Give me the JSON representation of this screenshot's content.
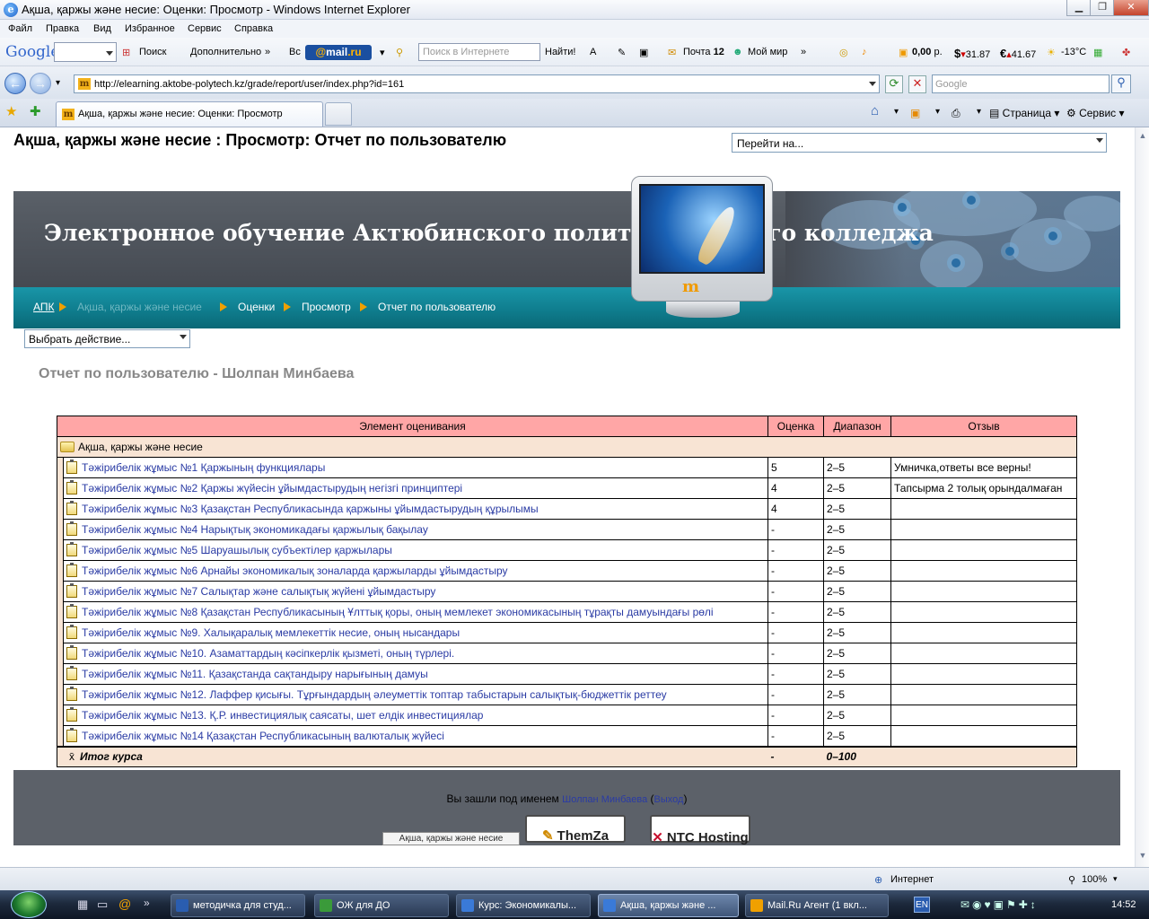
{
  "window": {
    "title": "Ақша, қаржы және несие: Оценки: Просмотр - Windows Internet Explorer"
  },
  "menu": [
    "Файл",
    "Правка",
    "Вид",
    "Избранное",
    "Сервис",
    "Справка"
  ],
  "google_toolbar": {
    "logo": "Google",
    "search_label": "Поиск",
    "more_label": "Дополнительно",
    "bc_label": "Вс",
    "mail_brand_a": "@",
    "mail_brand_b": "mail",
    "mail_brand_c": ".ru",
    "search_placeholder": "Поиск в Интернете",
    "find_label": "Найти!",
    "mail_label": "Почта",
    "mail_count": "12",
    "myworld_label": "Мой мир",
    "money_value": "0,00",
    "money_unit": "р.",
    "usd": "31.87",
    "eur": "41.67",
    "weather": "-13°С"
  },
  "address": {
    "url": "http://elearning.aktobe-polytech.kz/grade/report/user/index.php?id=161",
    "search_placeholder": "Google"
  },
  "tabs": {
    "active_label": "Ақша, қаржы және несие: Оценки: Просмотр",
    "page_label": "Страница",
    "tools_label": "Сервис"
  },
  "page": {
    "heading": "Ақша, қаржы және несие : Просмотр: Отчет по пользователю",
    "jump_placeholder": "Перейти на...",
    "banner_title": "Электронное обучение Актюбинского политехнического колледжа",
    "monitor_logo": "m",
    "breadcrumb": [
      "АПК",
      "Ақша, қаржы және несие",
      "Оценки",
      "Просмотр",
      "Отчет по пользователю"
    ],
    "action_select": "Выбрать действие...",
    "report_heading": "Отчет по пользователю - Шолпан Минбаева"
  },
  "table": {
    "headers": [
      "Элемент оценивания",
      "Оценка",
      "Диапазон",
      "Отзыв"
    ],
    "category": "Ақша, қаржы және несие",
    "rows": [
      {
        "item": "Тәжірибелік жұмыс №1 Қаржының функциялары",
        "grade": "5",
        "range": "2–5",
        "feedback": "Умничка,ответы все верны!"
      },
      {
        "item": "Тәжірибелік жұмыс №2 Қаржы жүйесін ұйымдастырудың негізгі принциптері",
        "grade": "4",
        "range": "2–5",
        "feedback": "Тапсырма 2 толық орындалмаған"
      },
      {
        "item": "Тәжірибелік жұмыс №3 Қазақстан Республикасында қаржыны ұйымдастырудың құрылымы",
        "grade": "4",
        "range": "2–5",
        "feedback": ""
      },
      {
        "item": "Тәжірибелік жұмыс №4 Нарықтық экономикадағы қаржылық бақылау",
        "grade": "-",
        "range": "2–5",
        "feedback": ""
      },
      {
        "item": "Тәжірибелік жұмыс №5 Шаруашылық субъектілер қаржылары",
        "grade": "-",
        "range": "2–5",
        "feedback": ""
      },
      {
        "item": "Тәжірибелік жұмыс №6 Арнайы экономикалық зоналарда қаржыларды ұйымдастыру",
        "grade": "-",
        "range": "2–5",
        "feedback": ""
      },
      {
        "item": "Тәжірибелік жұмыс №7 Салықтар және салықтық жүйені ұйымдастыру",
        "grade": "-",
        "range": "2–5",
        "feedback": ""
      },
      {
        "item": "Тәжірибелік жұмыс №8 Қазақстан Республикасының Ұлттық қоры, оның мемлекет экономикасының тұрақты дамуындағы рөлі",
        "grade": "-",
        "range": "2–5",
        "feedback": ""
      },
      {
        "item": "Тәжірибелік жұмыс №9. Халықаралық мемлекеттік несие, оның нысандары",
        "grade": "-",
        "range": "2–5",
        "feedback": ""
      },
      {
        "item": "Тәжірибелік жұмыс №10. Азаматтардың кәсіпкерлік қызметі, оның түрлері.",
        "grade": "-",
        "range": "2–5",
        "feedback": ""
      },
      {
        "item": "Тәжірибелік жұмыс №11. Қазақстанда сақтандыру нарығының дамуы",
        "grade": "-",
        "range": "2–5",
        "feedback": ""
      },
      {
        "item": "Тәжірибелік жұмыс №12. Лаффер қисығы. Тұрғындардың әлеуметтік топтар табыстарын салықтық-бюджеттік реттеу",
        "grade": "-",
        "range": "2–5",
        "feedback": ""
      },
      {
        "item": "Тәжірибелік жұмыс №13. Қ.Р. инвестициялық саясаты, шет елдік инвестициялар",
        "grade": "-",
        "range": "2–5",
        "feedback": ""
      },
      {
        "item": "Тәжірибелік жұмыс №14 Қазақстан Республикасының валюталық жүйесі",
        "grade": "-",
        "range": "2–5",
        "feedback": ""
      }
    ],
    "total": {
      "label": "Итог курса",
      "grade": "-",
      "range": "0–100"
    }
  },
  "footer": {
    "login_prefix": "Вы зашли под именем",
    "user": "Шолпан Минбаева",
    "logout": "Выход",
    "course_tab": "Ақша, қаржы және несие",
    "badge1": "ThemZa",
    "badge2": "NTC Hosting"
  },
  "status": {
    "zone": "Интернет",
    "zoom": "100%"
  },
  "taskbar": {
    "items": [
      "методичка для студ...",
      "ОЖ  для ДО",
      "Курс: Экономикалы...",
      "Ақша, қаржы және ...",
      "Mail.Ru Агент (1 вкл..."
    ],
    "lang": "EN",
    "clock": "14:52"
  },
  "colors": {
    "banner": "#4f555d",
    "crumbbar": "#0f7d8e",
    "table_header": "#ffa6a6",
    "category_row": "#f8e4d4",
    "link": "#2a3ba4"
  }
}
